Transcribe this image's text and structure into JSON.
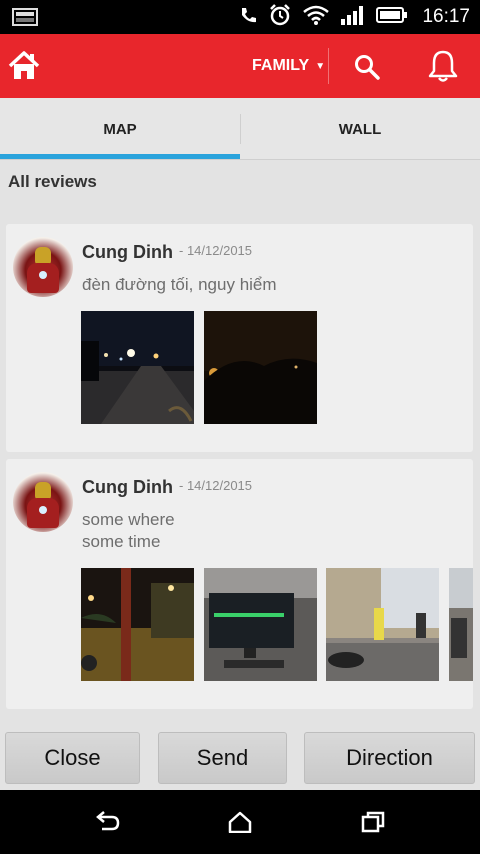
{
  "status_bar": {
    "time": "16:17"
  },
  "header": {
    "family_label": "FAMILY",
    "family_caret": "▼"
  },
  "tabs": [
    {
      "label": "MAP"
    },
    {
      "label": "WALL"
    }
  ],
  "reviews_title": "All reviews",
  "reviews": [
    {
      "author": "Cung Dinh",
      "date": "- 14/12/2015",
      "comment_lines": [
        "đèn đường tối, nguy hiểm"
      ]
    },
    {
      "author": "Cung Dinh",
      "date": "- 14/12/2015",
      "comment_lines": [
        "some where",
        "some time"
      ]
    }
  ],
  "buttons": {
    "close": "Close",
    "send": "Send",
    "direction": "Direction"
  },
  "colors": {
    "header_bg": "#e8262c",
    "tab_indicator": "#2aa3dc"
  }
}
